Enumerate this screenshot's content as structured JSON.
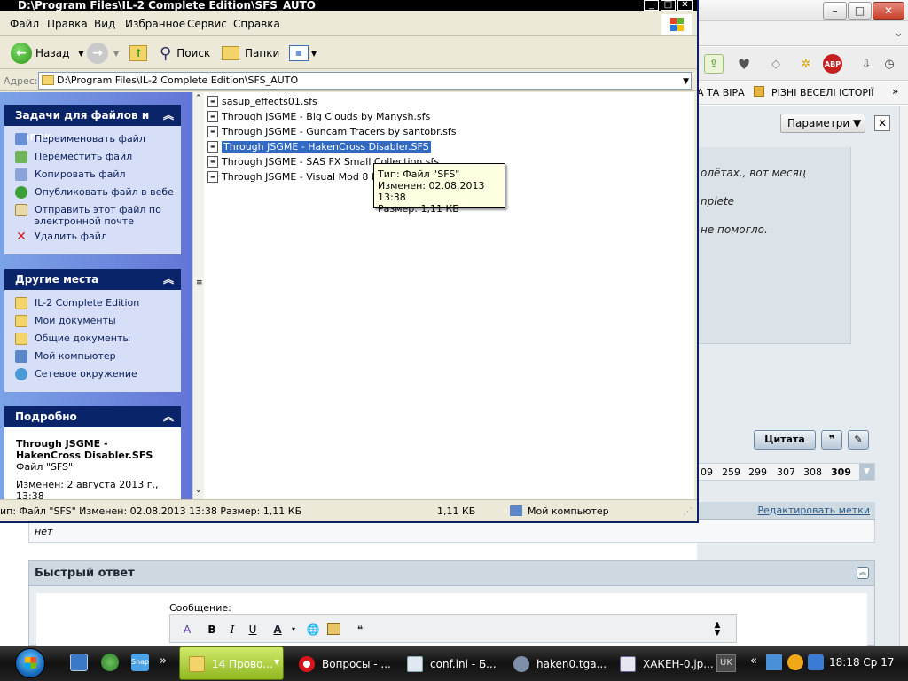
{
  "explorer": {
    "title": "D:\\Program Files\\IL-2 Complete Edition\\SFS_AUTO",
    "menu": [
      "Файл",
      "Правка",
      "Вид",
      "Избранное",
      "Сервис",
      "Справка"
    ],
    "toolbar": {
      "back": "Назад",
      "search": "Поиск",
      "folders": "Папки"
    },
    "address": {
      "label": "Адрес:",
      "value": "D:\\Program Files\\IL-2 Complete Edition\\SFS_AUTO"
    },
    "tasks_panel": {
      "title": "Задачи для файлов и папок",
      "items": [
        "Переименовать файл",
        "Переместить файл",
        "Копировать файл",
        "Опубликовать файл в вебе",
        "Отправить этот файл по электронной почте",
        "Удалить файл"
      ]
    },
    "places_panel": {
      "title": "Другие места",
      "items": [
        "IL-2 Complete Edition",
        "Мои документы",
        "Общие документы",
        "Мой компьютер",
        "Сетевое окружение"
      ]
    },
    "details_panel": {
      "title": "Подробно",
      "filename": "Through JSGME - HakenCross Disabler.SFS",
      "filetype": "Файл \"SFS\"",
      "modified": "Изменен: 2 августа 2013 г., 13:38"
    },
    "files": [
      "sasup_effects01.sfs",
      "Through JSGME - Big Clouds by Manysh.sfs",
      "Through JSGME - Guncam Tracers by santobr.sfs",
      "Through JSGME - HakenCross Disabler.SFS",
      "Through JSGME - SAS FX Small Collection.sfs",
      "Through JSGME - Visual Mod 8 by P"
    ],
    "selected_index": 3,
    "tooltip": {
      "type": "Тип: Файл \"SFS\"",
      "modified": "Изменен: 02.08.2013 13:38",
      "size": "Размер: 1,11 КБ"
    },
    "statusbar": {
      "info": "ип: Файл \"SFS\" Изменен: 02.08.2013 13:38 Размер: 1,11 КБ",
      "size": "1,11 КБ",
      "location": "Мой компьютер"
    }
  },
  "browser": {
    "bookmarks": [
      "А ТА ВІРА",
      "РІЗНІ ВЕСЕЛІ ІСТОРІЇ"
    ],
    "params_button": "Параметри ▼",
    "params_close": "✕",
    "post_lines": [
      "олётах., вот месяц",
      "nplete",
      "не помогло."
    ],
    "quote_button": "Цитата",
    "pager": [
      "09",
      "259",
      "299",
      "307",
      "308",
      "309"
    ],
    "edit_tags_link": "Редактировать метки",
    "tag_value": "нет",
    "quick_reply_title": "Быстрый ответ",
    "message_label": "Сообщение:"
  },
  "taskbar": {
    "tasks": [
      {
        "label": "14 Прово...",
        "active": true
      },
      {
        "label": "Вопросы - ...",
        "active": false
      },
      {
        "label": "conf.ini - Б...",
        "active": false
      },
      {
        "label": "haken0.tga...",
        "active": false
      },
      {
        "label": "ХАКЕН-0.jp...",
        "active": false
      }
    ],
    "lang": "UK",
    "clock": "18:18 Ср 17"
  },
  "colors": {
    "xp_selection": "#316ac5",
    "taskpane_gradient_left": "#7ba2e7",
    "taskpane_gradient_right": "#6375d6",
    "tooltip_bg": "#ffffe1",
    "active_task": "#a8cc3a"
  }
}
